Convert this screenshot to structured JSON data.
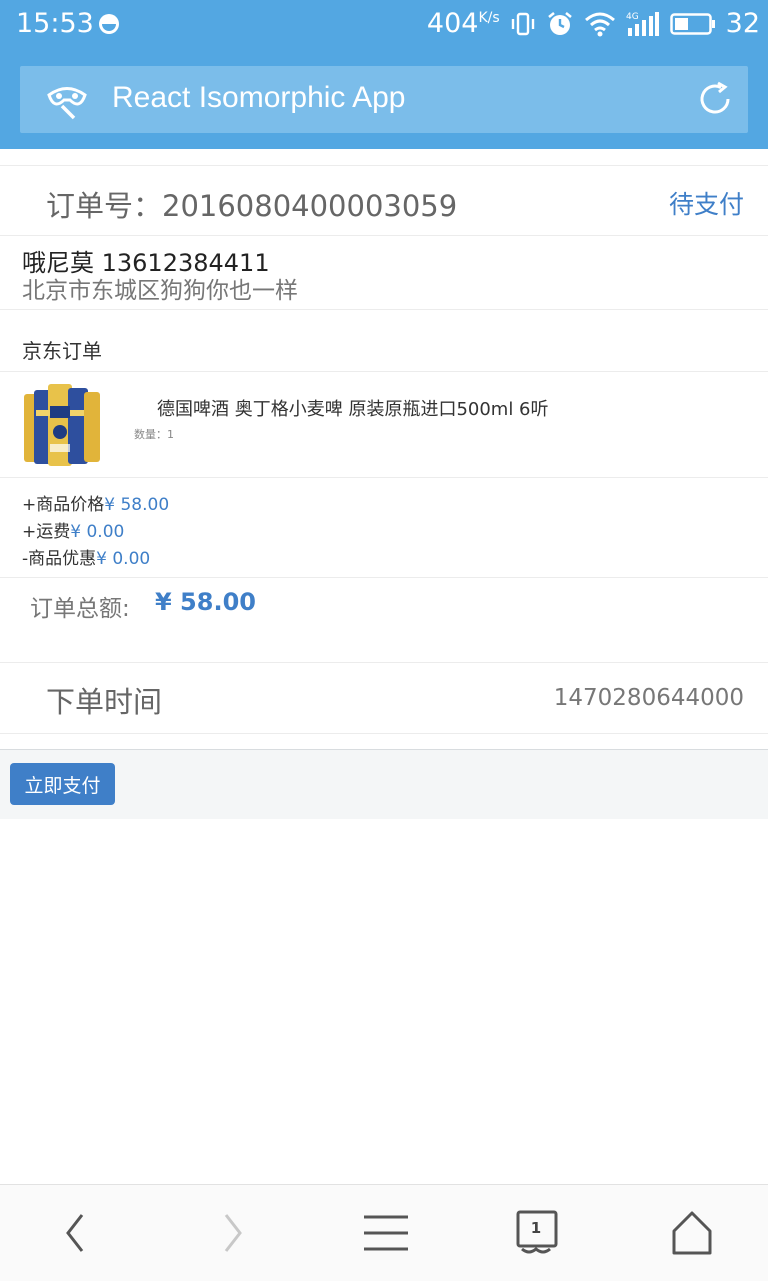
{
  "status_bar": {
    "time": "15:53",
    "speed": "404",
    "speed_unit": "K/s",
    "network": "4G",
    "battery": "32"
  },
  "app": {
    "title": "React Isomorphic App"
  },
  "order": {
    "number_label": "订单号：2016080400003059",
    "status": "待支付"
  },
  "address": {
    "name_phone": "哦尼莫 13612384411",
    "detail": "北京市东城区狗狗你也一样"
  },
  "shop": {
    "name": "京东订单"
  },
  "product": {
    "title": "德国啤酒 奥丁格小麦啤 原装原瓶进口500ml 6听",
    "quantity": "数量：1"
  },
  "fees": {
    "price_label": "+商品价格",
    "price": "¥ 58.00",
    "shipping_label": "+运费",
    "shipping": "¥ 0.00",
    "discount_label": "-商品优惠",
    "discount": "¥ 0.00"
  },
  "total": {
    "label": "订单总额:",
    "amount": "¥ 58.00"
  },
  "order_time": {
    "label": "下单时间",
    "value": "1470280644000"
  },
  "actions": {
    "pay_label": "立即支付"
  },
  "browser_nav": {
    "tab_count": "1"
  },
  "colors": {
    "header": "#53a7e2",
    "header_bar": "#7bbdea",
    "accent": "#3f7fc8"
  }
}
